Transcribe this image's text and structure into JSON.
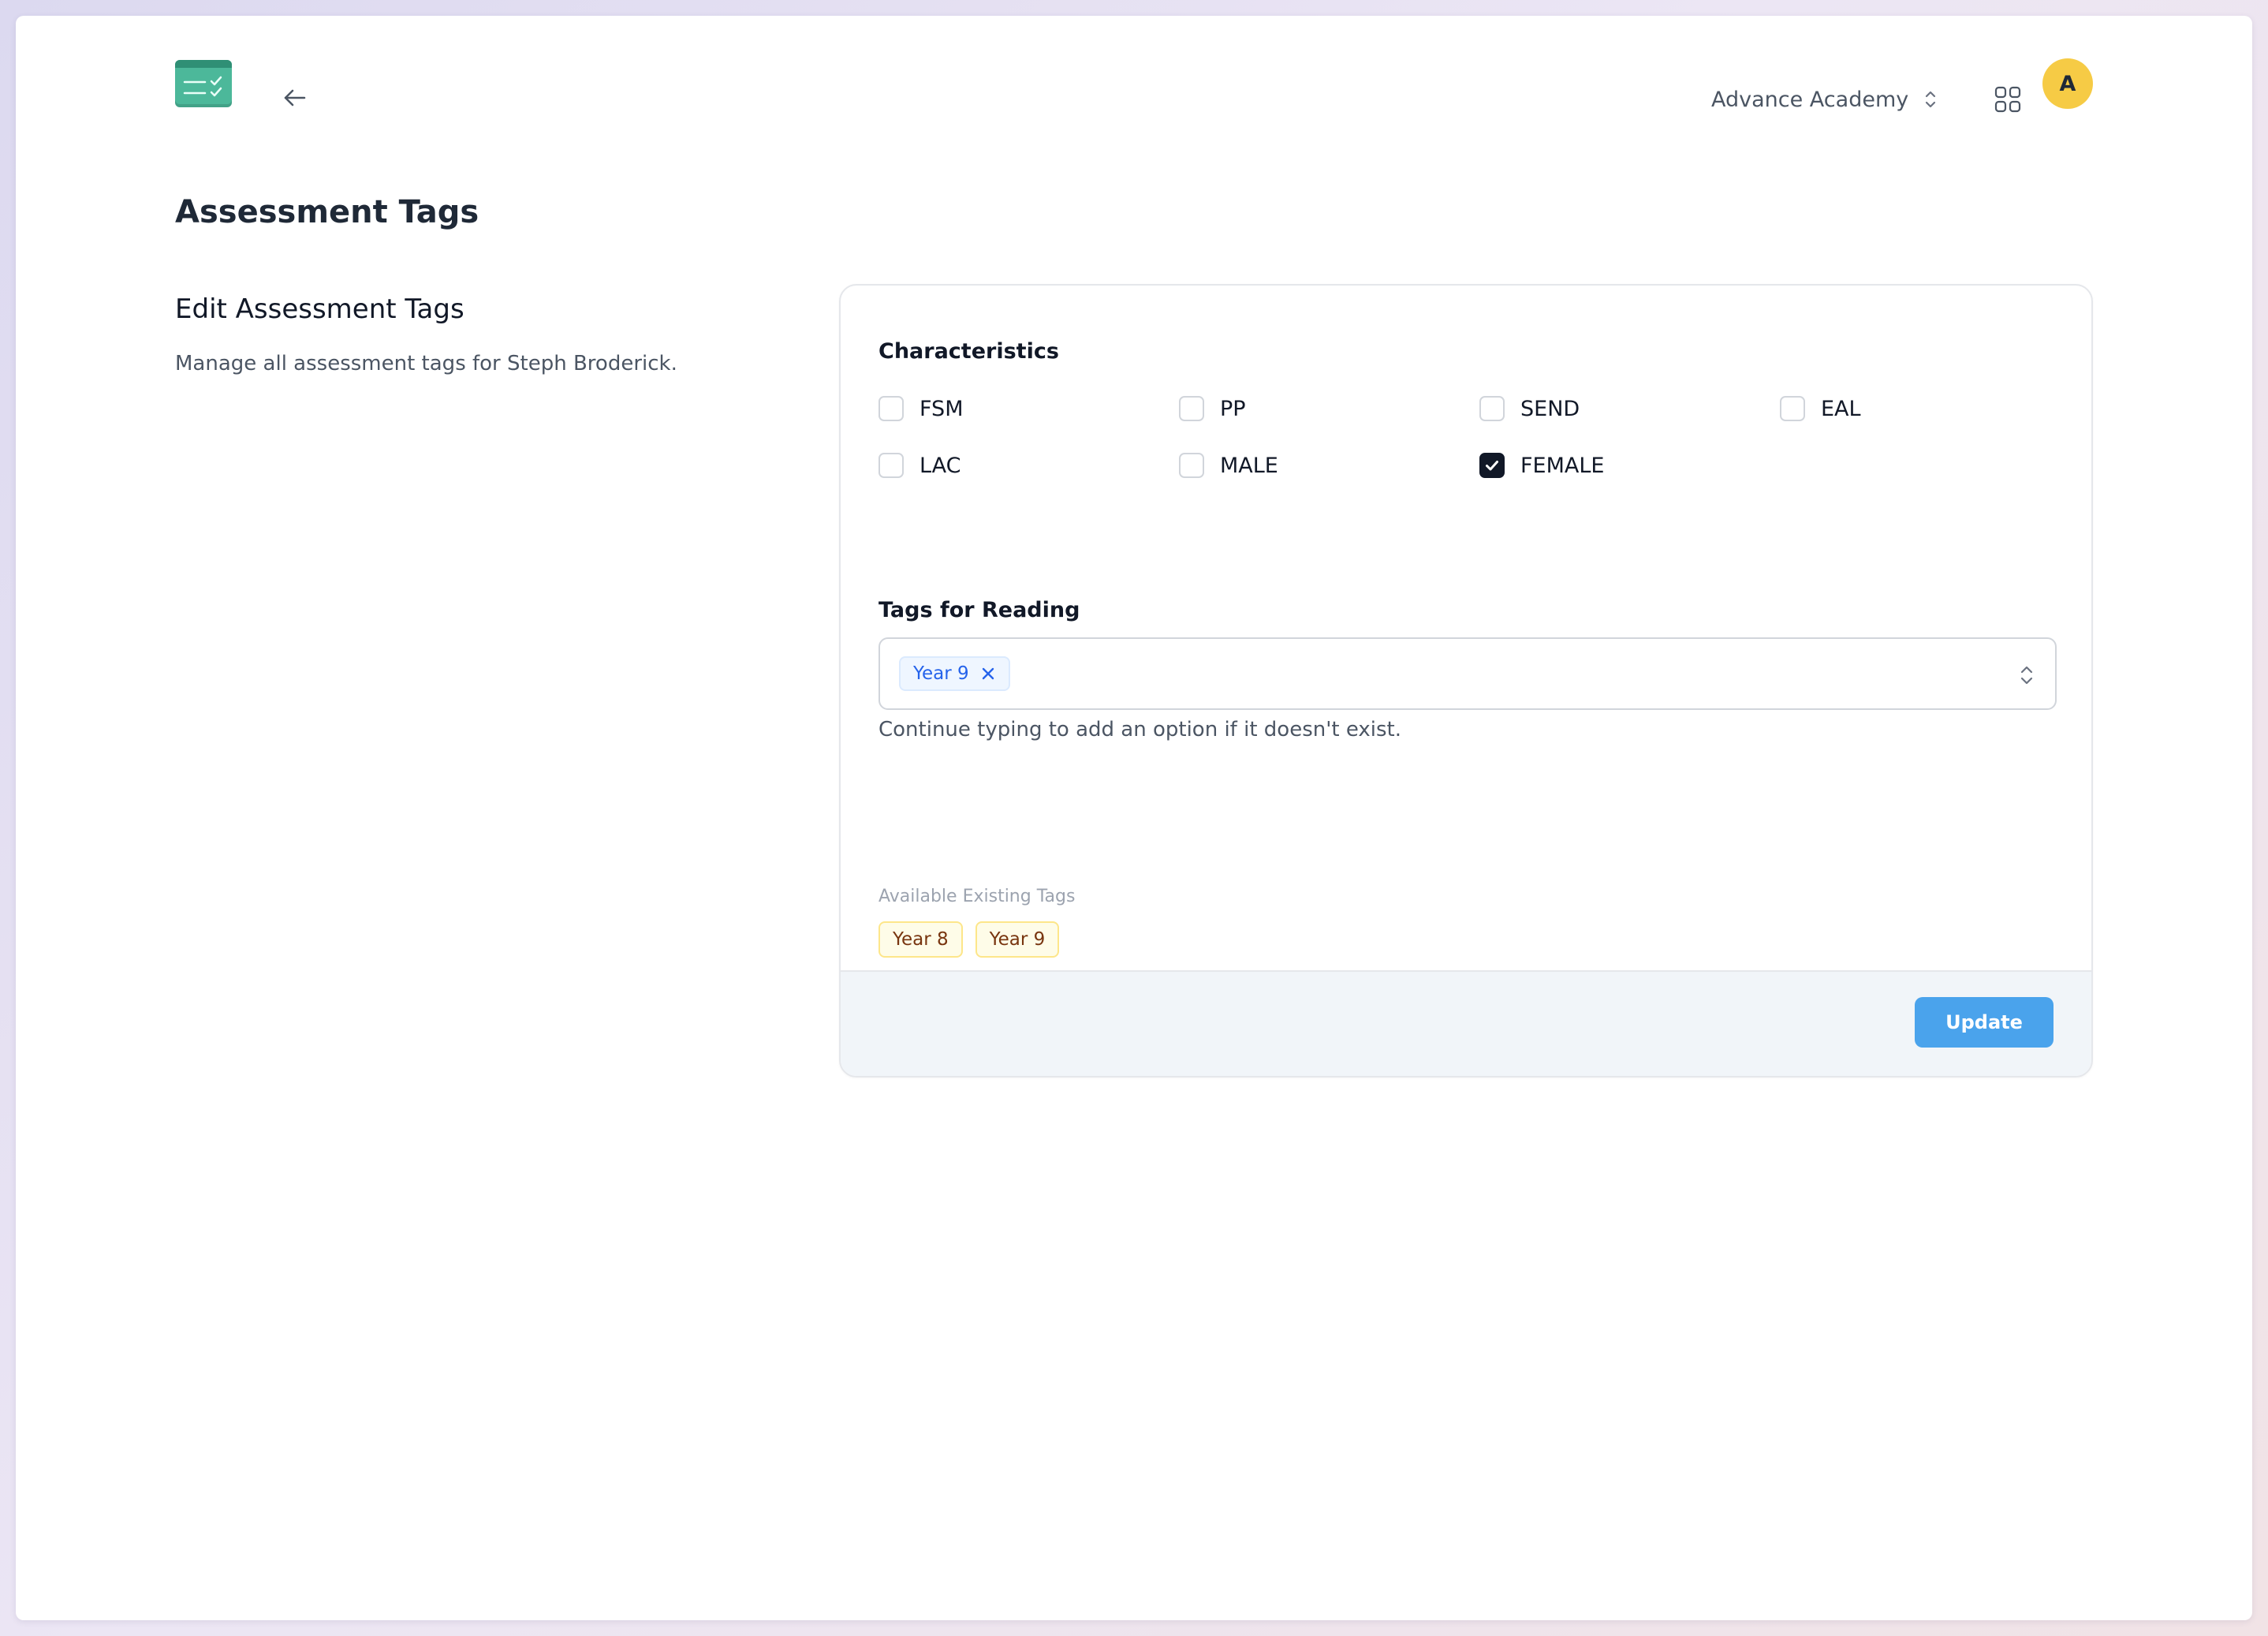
{
  "header": {
    "school_name": "Advance Academy",
    "avatar_initial": "A"
  },
  "page": {
    "title": "Assessment Tags"
  },
  "section": {
    "title": "Edit Assessment Tags",
    "description": "Manage all assessment tags for Steph Broderick."
  },
  "characteristics": {
    "label": "Characteristics",
    "items": [
      {
        "label": "FSM",
        "checked": false
      },
      {
        "label": "PP",
        "checked": false
      },
      {
        "label": "SEND",
        "checked": false
      },
      {
        "label": "EAL",
        "checked": false
      },
      {
        "label": "LAC",
        "checked": false
      },
      {
        "label": "MALE",
        "checked": false
      },
      {
        "label": "FEMALE",
        "checked": true
      }
    ]
  },
  "reading": {
    "label": "Tags for Reading",
    "selected": [
      "Year 9"
    ],
    "helper": "Continue typing to add an option if it doesn't exist."
  },
  "existing": {
    "label": "Available Existing Tags",
    "tags": [
      "Year 8",
      "Year 9"
    ]
  },
  "footer": {
    "update_label": "Update"
  },
  "colors": {
    "logo": "#4cb89a",
    "avatar": "#f6cb45",
    "primary_button": "#4aa3ec",
    "chip_text": "#2563eb",
    "tag_background": "#fefce8"
  }
}
